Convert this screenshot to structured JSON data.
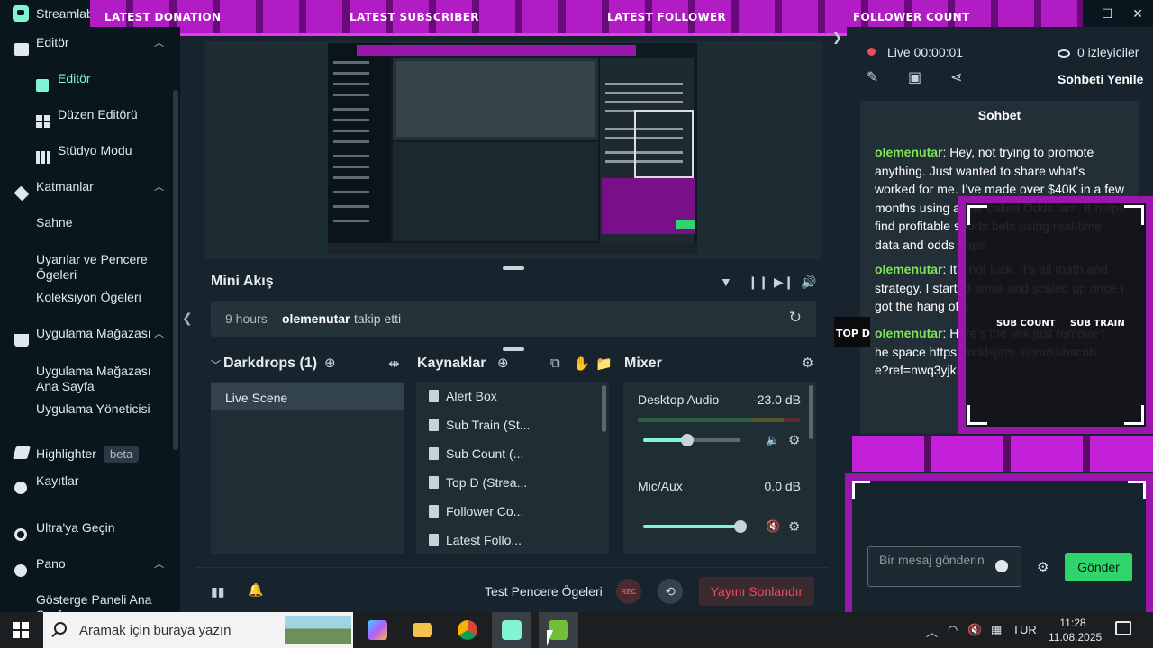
{
  "app": {
    "name": "Streamlabs"
  },
  "overlay": {
    "top_labels": [
      "LATEST DONATION",
      "LATEST SUBSCRIBER",
      "LATEST FOLLOWER",
      "FOLLOWER COUNT"
    ],
    "side_labels": {
      "sub_count": "SUB COUNT",
      "sub_train": "SUB TRAIN",
      "top_d": "TOP D"
    },
    "accent": "#9b16ad"
  },
  "sidebar": {
    "items": [
      {
        "label": "Editör",
        "type": "section",
        "expanded": true,
        "icon": "editor-icon"
      },
      {
        "label": "Editör",
        "type": "sub",
        "active": true,
        "icon": "editor-active-icon"
      },
      {
        "label": "Düzen Editörü",
        "type": "sub",
        "icon": "layout-grid-icon"
      },
      {
        "label": "Stüdyo Modu",
        "type": "sub",
        "icon": "studio-mode-icon"
      },
      {
        "label": "Katmanlar",
        "type": "section",
        "expanded": true,
        "icon": "layers-icon"
      },
      {
        "label": "Sahne",
        "type": "text"
      },
      {
        "label": "Uyarılar ve Pencere Ögeleri",
        "type": "text"
      },
      {
        "label": "Koleksiyon Ögeleri",
        "type": "text"
      },
      {
        "label": "Uygulama Mağazası",
        "type": "section",
        "expanded": true,
        "icon": "app-store-icon"
      },
      {
        "label": "Uygulama Mağazası Ana Sayfa",
        "type": "text"
      },
      {
        "label": "Uygulama Yöneticisi",
        "type": "text"
      },
      {
        "label": "Highlighter",
        "type": "section",
        "badge": "beta",
        "icon": "highlighter-icon"
      },
      {
        "label": "Kayıtlar",
        "type": "section",
        "icon": "recordings-icon"
      },
      {
        "label": "Ultra'ya Geçin",
        "type": "section",
        "icon": "ultra-icon"
      },
      {
        "label": "Pano",
        "type": "section",
        "expanded": true,
        "icon": "dashboard-icon"
      },
      {
        "label": "Gösterge Paneli Ana Sayfa",
        "type": "text"
      }
    ]
  },
  "mini_feed": {
    "title": "Mini Akış",
    "event": {
      "time": "9 hours",
      "user": "olemenutar",
      "action": "takip etti"
    }
  },
  "scenes": {
    "title": "Darkdrops (1)",
    "items": [
      "Live Scene"
    ]
  },
  "sources": {
    "title": "Kaynaklar",
    "items": [
      "Alert Box",
      "Sub Train (St...",
      "Sub Count (...",
      "Top D (Strea...",
      "Follower Co...",
      "Latest Follo..."
    ]
  },
  "mixer": {
    "title": "Mixer",
    "channels": [
      {
        "name": "Desktop Audio",
        "db": "-23.0 dB",
        "level": 0.45,
        "muted": false
      },
      {
        "name": "Mic/Aux",
        "db": "0.0 dB",
        "level": 1.0,
        "muted": true
      }
    ]
  },
  "footer": {
    "test_label": "Test Pencere Ögeleri",
    "rec_label": "REC",
    "end_stream": "Yayını Sonlandır"
  },
  "stream": {
    "live_label": "Live",
    "duration": "00:00:01",
    "viewers": "0 izleyiciler",
    "refresh_chat": "Sohbeti Yenile"
  },
  "chat": {
    "title": "Sohbet",
    "messages": [
      {
        "user": "olemenutar",
        "text": "Hey, not trying to promote anything. Just wanted to share what’s worked for me. I’ve made over $40K in a few months using a site called OddsJam. It helps find profitable sports bets using real-time data and odds gaps."
      },
      {
        "user": "olemenutar",
        "text": "It’s not luck. It’s all math and strategy. I started small and scaled up once I got the hang of it."
      },
      {
        "user": "olemenutar",
        "text": "Here’s the link just remove the space https://oddsjam .com/subscribe?ref=nwq3yjk"
      }
    ],
    "input_placeholder": "Bir mesaj gönderin",
    "send_label": "Gönder",
    "send_color": "#2fd56b"
  },
  "taskbar": {
    "search_placeholder": "Aramak için buraya yazın",
    "language": "TUR",
    "time": "11:28",
    "date": "11.08.2025"
  }
}
